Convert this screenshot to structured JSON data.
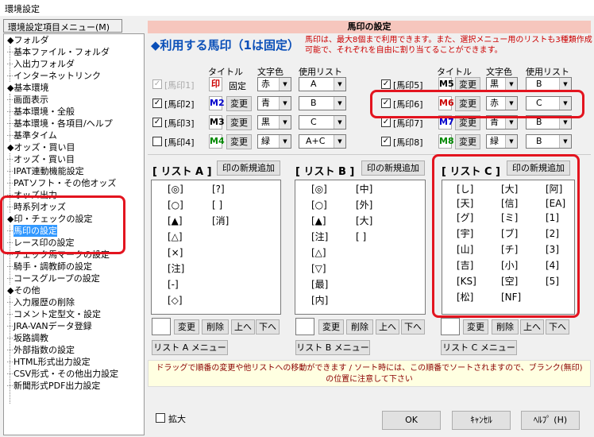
{
  "window": {
    "title": "環境設定"
  },
  "menu": {
    "caption": "環境設定項目メニュー(M)",
    "items": [
      {
        "label": "◆フォルダ",
        "group": true
      },
      {
        "label": "基本ファイル・フォルダ"
      },
      {
        "label": "入出力フォルダ"
      },
      {
        "label": "インターネットリンク"
      },
      {
        "label": "◆基本環境",
        "group": true
      },
      {
        "label": "画面表示"
      },
      {
        "label": "基本環境・全般"
      },
      {
        "label": "基本環境・各項目/ヘルプ"
      },
      {
        "label": "基準タイム"
      },
      {
        "label": "◆オッズ・買い目",
        "group": true
      },
      {
        "label": "オッズ・買い目"
      },
      {
        "label": "IPAT連動機能設定"
      },
      {
        "label": "PATソフト・その他オッズ"
      },
      {
        "label": "オッズ出力"
      },
      {
        "label": "時系列オッズ"
      },
      {
        "label": "◆印・チェックの設定",
        "group": true
      },
      {
        "label": "馬印の設定",
        "selected": true
      },
      {
        "label": "レース印の設定"
      },
      {
        "label": "チェック馬マークの設定"
      },
      {
        "label": "騎手・調教師の設定"
      },
      {
        "label": "コースグループの設定"
      },
      {
        "label": "◆その他",
        "group": true
      },
      {
        "label": "入力履歴の削除"
      },
      {
        "label": "コメント定型文・設定"
      },
      {
        "label": "JRA-VANデータ登録"
      },
      {
        "label": "坂路調教"
      },
      {
        "label": "外部指数の設定"
      },
      {
        "label": "HTML形式出力設定"
      },
      {
        "label": "CSV形式・その他出力設定"
      },
      {
        "label": "新聞形式PDF出力設定"
      }
    ]
  },
  "panel": {
    "header": "馬印の設定",
    "heading": "◆利用する馬印（1は固定）",
    "description": "馬印は、最大8個まで利用できます。また、選択メニュー用のリストも3種類作成可能で、それぞれを自由に割り当てることができます。",
    "col_headers": {
      "title": "タイトル",
      "color": "文字色",
      "list": "使用リスト"
    },
    "fixed_label": "固定",
    "change_label": "変更",
    "marks": [
      {
        "check": true,
        "label": "[馬印1]",
        "tag": "印",
        "tag_color": "#cc0000",
        "tag_bg": "#ffffff",
        "color": "赤",
        "list": "A",
        "disabled": true
      },
      {
        "check": true,
        "label": "[馬印2]",
        "tag": "M2",
        "tag_color": "#0000cc",
        "color": "青",
        "list": "B"
      },
      {
        "check": true,
        "label": "[馬印3]",
        "tag": "M3",
        "tag_color": "#000000",
        "color": "黒",
        "list": "C"
      },
      {
        "check": false,
        "label": "[馬印4]",
        "tag": "M4",
        "tag_color": "#008800",
        "color": "緑",
        "list": "A+C"
      },
      {
        "check": true,
        "label": "[馬印5]",
        "tag": "M5",
        "tag_color": "#000000",
        "color": "黒",
        "list": "B"
      },
      {
        "check": true,
        "label": "[馬印6]",
        "tag": "M6",
        "tag_color": "#cc0000",
        "color": "赤",
        "list": "C"
      },
      {
        "check": true,
        "label": "[馬印7]",
        "tag": "M7",
        "tag_color": "#0000cc",
        "color": "青",
        "list": "B"
      },
      {
        "check": true,
        "label": "[馬印8]",
        "tag": "M8",
        "tag_color": "#008800",
        "color": "緑",
        "list": "B"
      }
    ],
    "lists": [
      {
        "title": "[ リスト A ]",
        "add": "印の新規追加",
        "menu": "リスト A メニュー",
        "items": [
          "[◎]",
          "[?]",
          "[○]",
          "[ ]",
          "[▲]",
          "[消]",
          "[△]",
          "[×]",
          "[注]",
          "[-]",
          "[◇]"
        ]
      },
      {
        "title": "[ リスト B ]",
        "add": "印の新規追加",
        "menu": "リスト B メニュー",
        "items": [
          "[◎]",
          "[中]",
          "[○]",
          "[外]",
          "[▲]",
          "[大]",
          "[注]",
          "[ ]",
          "[△]",
          "[▽]",
          "[最]",
          "[内]"
        ]
      },
      {
        "title": "[ リスト C ]",
        "add": "印の新規追加",
        "menu": "リスト C メニュー",
        "items": [
          "[し]",
          "[大]",
          "[阿]",
          "[天]",
          "[信]",
          "[EA]",
          "[グ]",
          "[ミ]",
          "[1]",
          "[宇]",
          "[ブ]",
          "[2]",
          "[山]",
          "[チ]",
          "[3]",
          "[吉]",
          "[小]",
          "[4]",
          "[KS]",
          "[空]",
          "[5]",
          "[松]",
          "[NF]"
        ]
      }
    ],
    "list_buttons": {
      "change": "変更",
      "delete": "削除",
      "up": "上へ",
      "down": "下へ"
    },
    "note": "ドラッグで順番の変更や他リストへの移動ができます / ソート時には、この順番でソートされますので、ブランク(無印)の位置に注意して下さい",
    "enlarge": "拡大",
    "ok": "OK",
    "cancel": "ｷｬﾝｾﾙ",
    "help": "ﾍﾙﾌﾟ (H)"
  }
}
